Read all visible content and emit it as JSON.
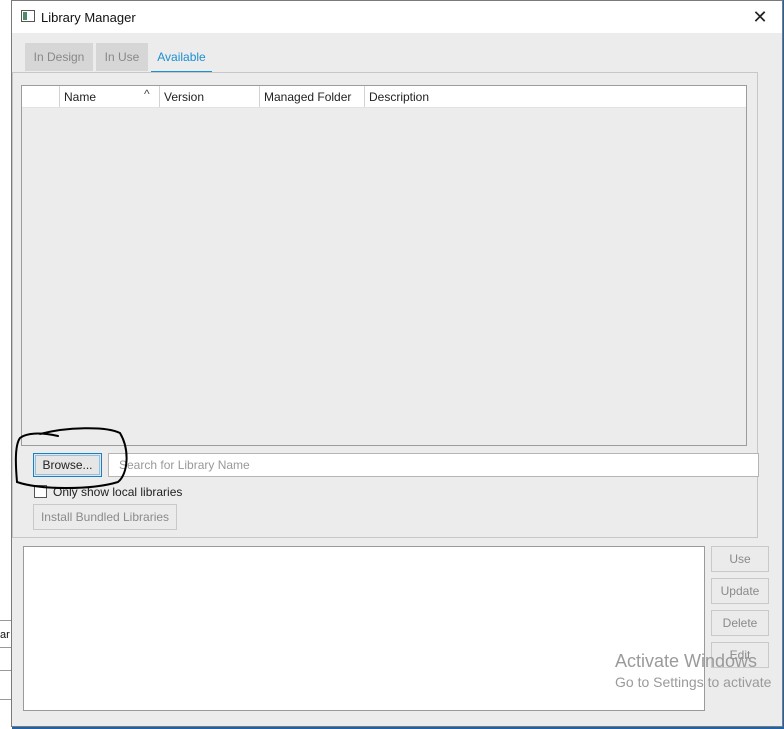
{
  "background": {
    "left_text": "ar"
  },
  "window": {
    "title": "Library Manager",
    "close_glyph": "✕"
  },
  "tabs": [
    {
      "label": "In Design",
      "active": false
    },
    {
      "label": "In Use",
      "active": false
    },
    {
      "label": "Available",
      "active": true
    }
  ],
  "table": {
    "columns": [
      "",
      "Name",
      "Version",
      "Managed Folder",
      "Description"
    ],
    "sorted_by": "Name",
    "sort_glyph": "^",
    "rows": []
  },
  "browse": {
    "label": "Browse..."
  },
  "search": {
    "placeholder": "Search for Library Name",
    "value": ""
  },
  "local_only": {
    "label": "Only show local libraries",
    "checked": false
  },
  "install_bundled": {
    "label": "Install Bundled Libraries"
  },
  "side_buttons": {
    "use": "Use",
    "update": "Update",
    "delete": "Delete",
    "edit": "Edit"
  },
  "watermark": {
    "title": "Activate Windows",
    "subtitle": "Go to Settings to activate"
  },
  "colors": {
    "accent": "#1b8fd2",
    "window_bg": "#ececec",
    "desktop": "#1e63a8"
  }
}
